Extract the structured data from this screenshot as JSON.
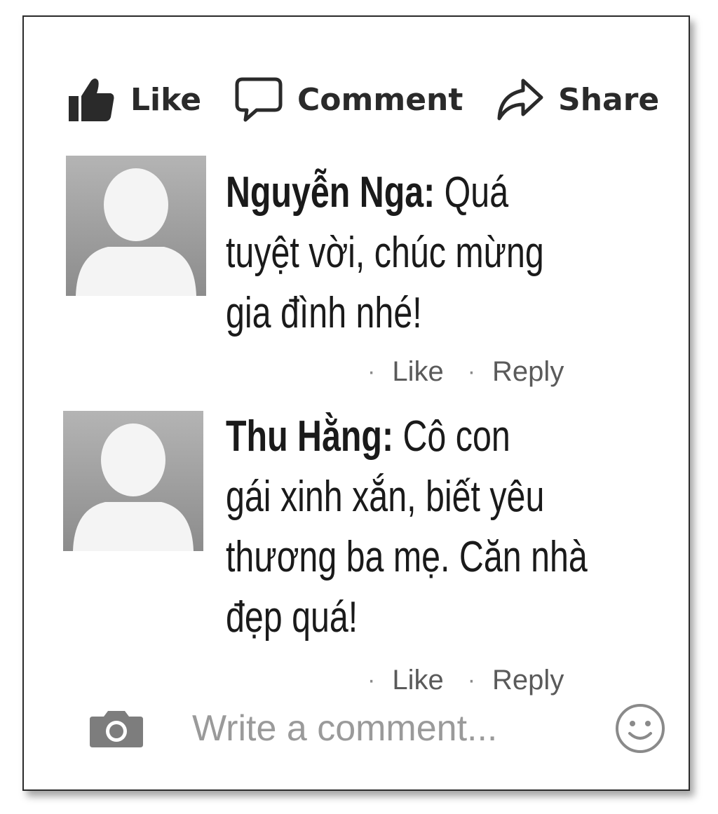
{
  "actions": {
    "like_label": "Like",
    "comment_label": "Comment",
    "share_label": "Share"
  },
  "comments": [
    {
      "author": "Nguyễn Nga:",
      "lines": [
        "Quá",
        "tuyệt vời, chúc mừng",
        "gia đình nhé!"
      ],
      "like_label": "Like",
      "reply_label": "Reply"
    },
    {
      "author": "Thu Hằng:",
      "lines": [
        "Cô con",
        "gái xinh xắn, biết yêu",
        "thương ba mẹ. Căn nhà",
        "đẹp quá!"
      ],
      "like_label": "Like",
      "reply_label": "Reply"
    }
  ],
  "composer": {
    "placeholder": "Write a comment..."
  },
  "icons": {
    "like": "thumbs-up-icon",
    "comment": "speech-bubble-icon",
    "share": "share-arrow-icon",
    "camera": "camera-icon",
    "emoji": "smiley-icon"
  }
}
